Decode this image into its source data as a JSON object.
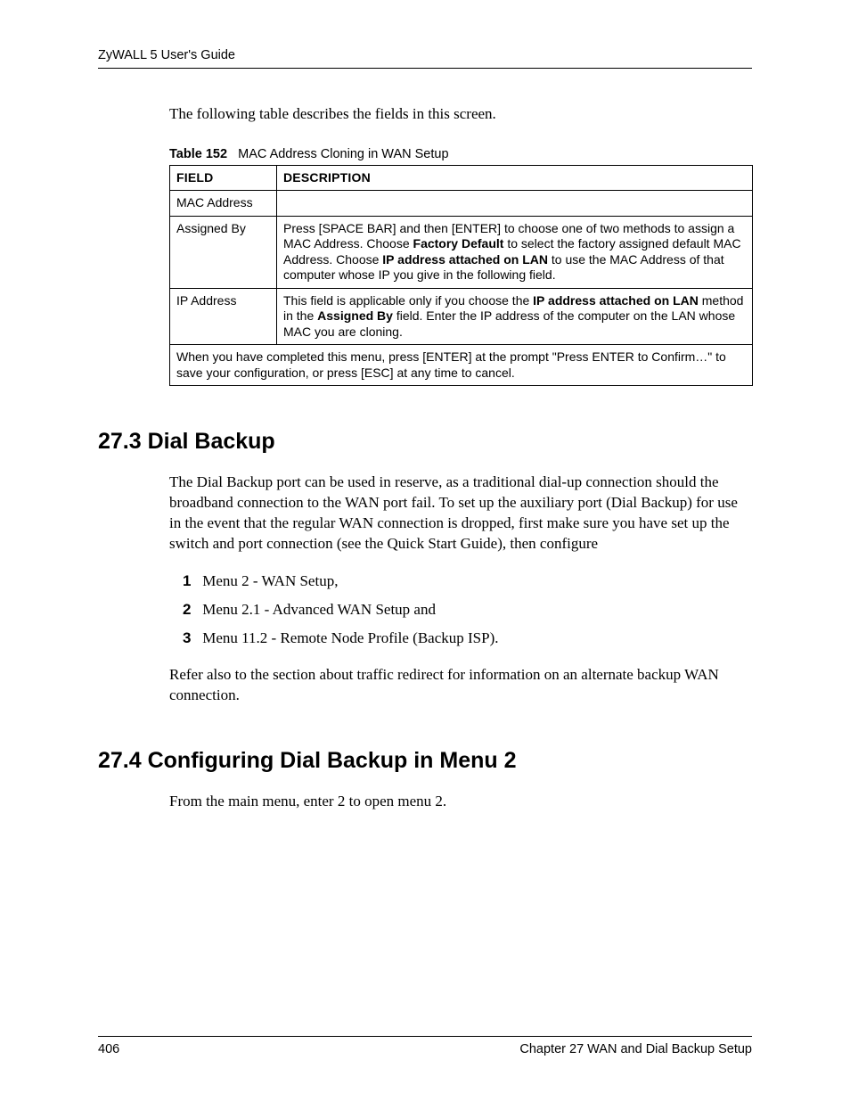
{
  "header": {
    "title": "ZyWALL 5 User's Guide"
  },
  "intro": "The following table describes the fields in this screen.",
  "table": {
    "caption_label": "Table 152",
    "caption_text": "MAC Address Cloning in WAN Setup",
    "head": {
      "field": "FIELD",
      "description": "DESCRIPTION"
    },
    "rows": {
      "r0": {
        "field": "MAC Address",
        "desc": ""
      },
      "r1": {
        "field": "Assigned By",
        "desc_1": "Press [SPACE BAR] and then [ENTER] to choose one of two methods to assign a MAC Address. Choose ",
        "desc_b1": "Factory Default",
        "desc_2": " to select the factory assigned default MAC Address. Choose ",
        "desc_b2": "IP address attached on LAN",
        "desc_3": " to use the MAC Address of that computer whose IP you give in the following field."
      },
      "r2": {
        "field": "IP Address",
        "desc_1": "This field is applicable only if you choose the ",
        "desc_b1": "IP address attached on LAN",
        "desc_2": " method in the ",
        "desc_b2": "Assigned By",
        "desc_3": " field. Enter the IP address of the computer on the LAN whose MAC you are cloning."
      }
    },
    "footer": "When you have completed this menu, press [ENTER] at the prompt \"Press ENTER to Confirm…\" to save your configuration, or press [ESC] at any time to cancel."
  },
  "section273": {
    "title": "27.3  Dial Backup",
    "para1": "The Dial Backup port can be used in reserve, as a traditional dial-up connection should the broadband connection to the WAN port fail. To set up the auxiliary port (Dial Backup) for use in the event that the regular WAN connection is dropped, first make sure you have set up the switch and port connection (see the Quick Start Guide), then configure",
    "steps": {
      "n1": "1",
      "s1": "Menu 2 - WAN Setup,",
      "n2": "2",
      "s2": "Menu 2.1 - Advanced WAN Setup and",
      "n3": "3",
      "s3": "Menu 11.2 - Remote Node Profile (Backup ISP)."
    },
    "para2": " Refer also to the section about traffic redirect for information on an alternate backup WAN connection."
  },
  "section274": {
    "title": "27.4  Configuring Dial Backup in Menu 2",
    "para1": "From the main menu, enter 2 to open menu 2."
  },
  "footer": {
    "page": "406",
    "chapter": "Chapter 27 WAN and Dial Backup Setup"
  }
}
